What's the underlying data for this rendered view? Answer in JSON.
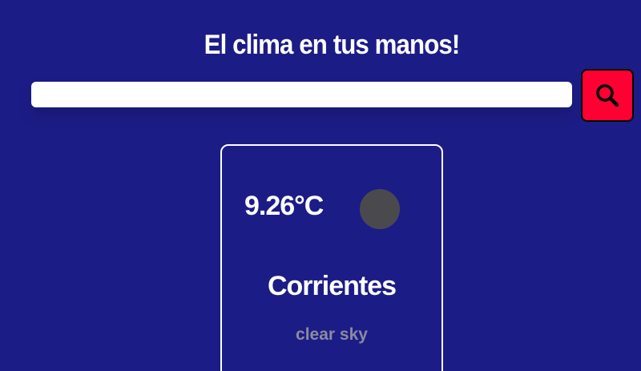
{
  "header": {
    "title": "El clima en tus manos!"
  },
  "search": {
    "value": "",
    "placeholder": "",
    "button_icon": "search-icon"
  },
  "weather_card": {
    "temperature": "9.26°C",
    "icon": "weather-icon-placeholder",
    "city": "Corrientes",
    "description": "clear sky"
  },
  "colors": {
    "background": "#1c1c86",
    "search_button": "#ff0033",
    "card_border": "#ffffff",
    "description_text": "#8a8aa4",
    "icon_placeholder": "#4a4a4e"
  }
}
